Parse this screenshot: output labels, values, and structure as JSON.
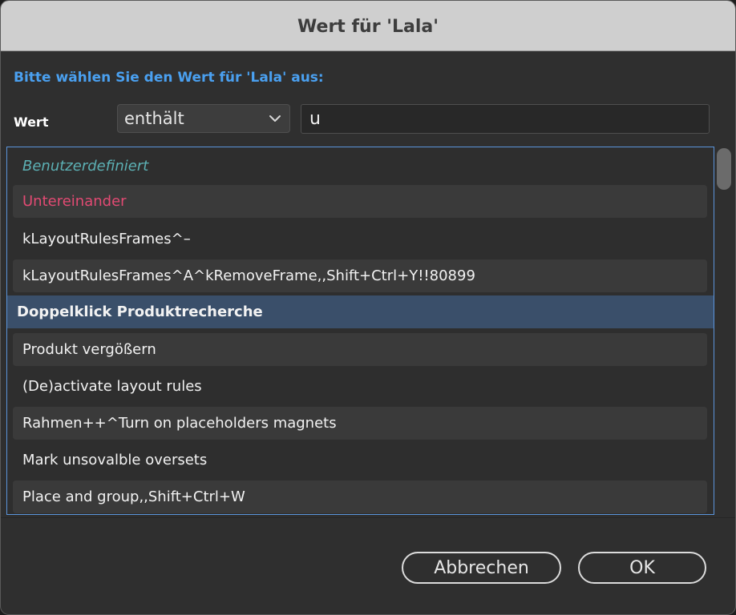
{
  "window": {
    "title": "Wert für 'Lala'"
  },
  "prompt": "Bitte wählen Sie den Wert für 'Lala' aus:",
  "field_label": "Wert",
  "operator_select": {
    "selected": "enthält",
    "icon": "chevron-down-icon"
  },
  "value_input": {
    "value": "u"
  },
  "list": {
    "items": [
      {
        "label": "Benutzerdefiniert",
        "style": "custom"
      },
      {
        "label": "Untereinander",
        "style": "pink"
      },
      {
        "label": "kLayoutRulesFrames^–",
        "style": "normal"
      },
      {
        "label": "kLayoutRulesFrames^A^kRemoveFrame,,Shift+Ctrl+Y!!80899",
        "style": "normal"
      },
      {
        "label": "Doppelklick Produktrecherche",
        "style": "selected"
      },
      {
        "label": "Produkt vergößern",
        "style": "normal"
      },
      {
        "label": "(De)activate layout rules",
        "style": "normal"
      },
      {
        "label": "Rahmen++^Turn on placeholders magnets",
        "style": "normal"
      },
      {
        "label": "Mark unsovalble oversets",
        "style": "normal"
      },
      {
        "label": "Place and group,,Shift+Ctrl+W",
        "style": "normal"
      }
    ]
  },
  "buttons": {
    "cancel_label": "Abbrechen",
    "ok_label": "OK"
  },
  "colors": {
    "prompt": "#4aa0f0",
    "custom_item": "#5cb0b4",
    "pink_item": "#e24a73",
    "selection": "#3a4f6a",
    "list_border": "#5b95db"
  }
}
